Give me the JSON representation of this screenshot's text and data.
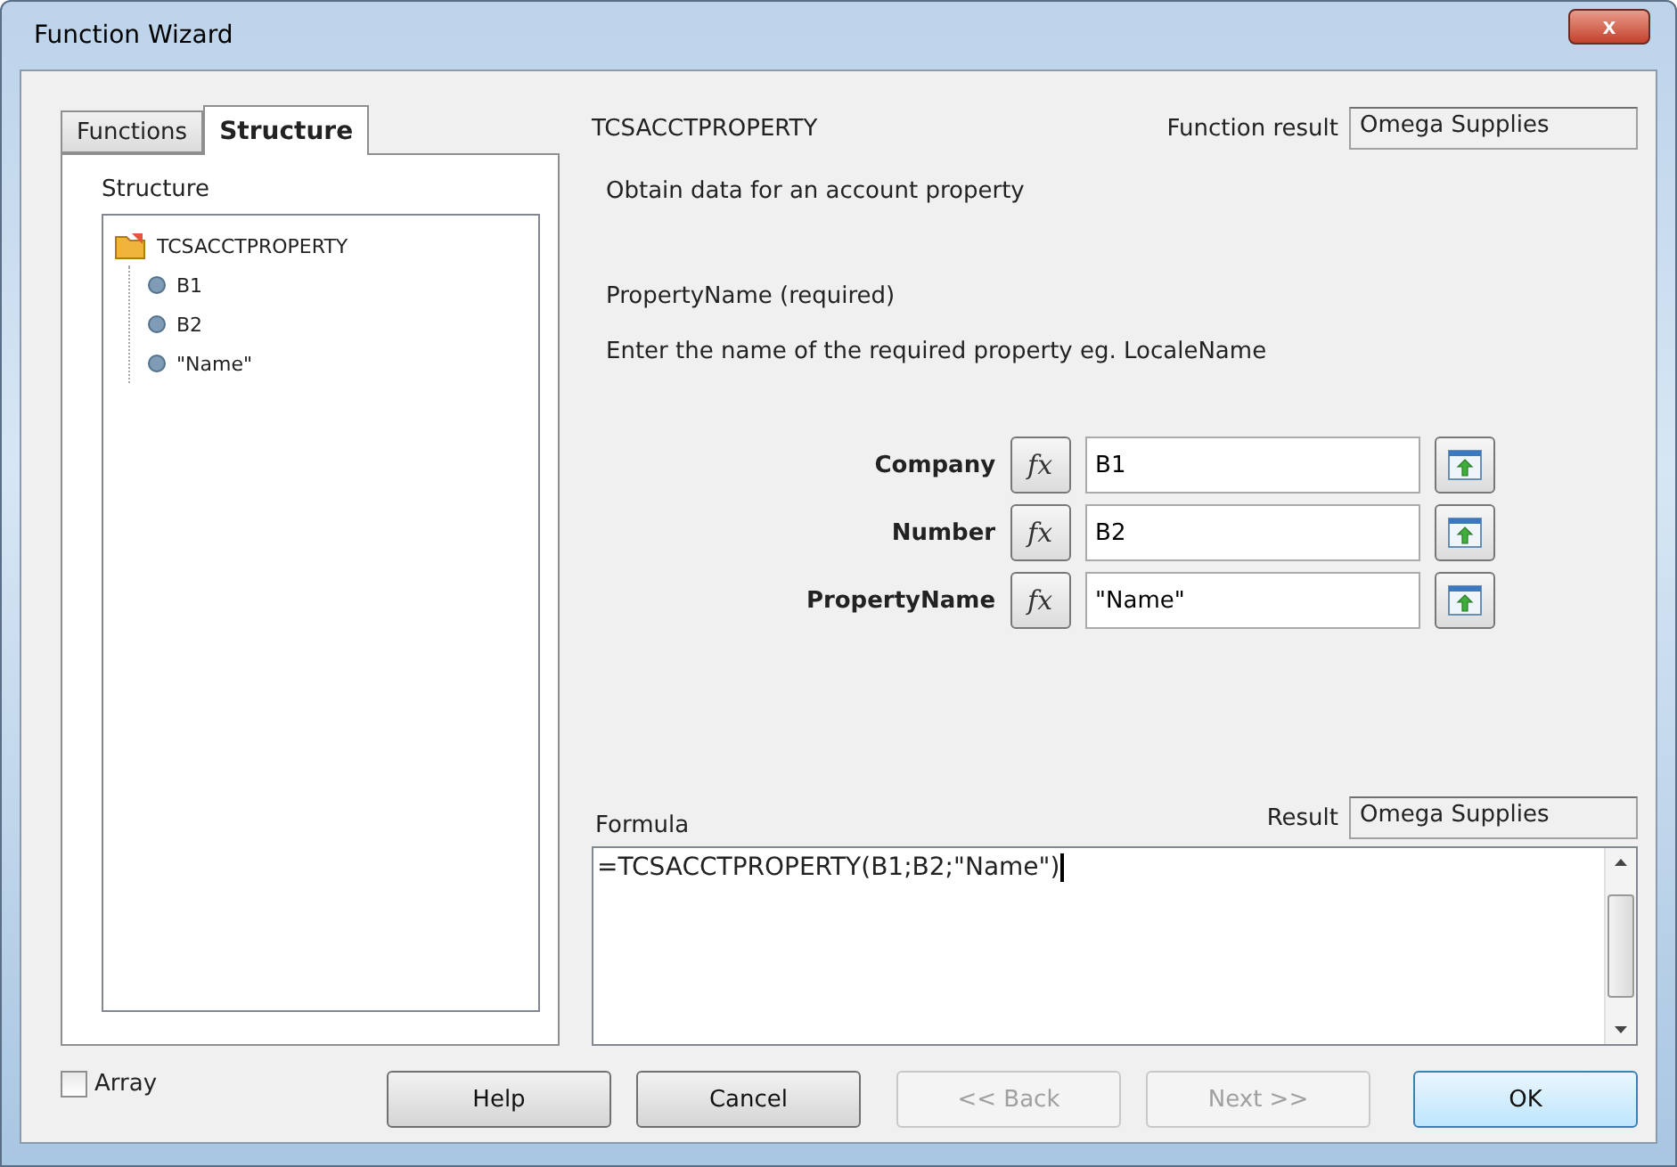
{
  "window": {
    "title": "Function Wizard",
    "close": "x"
  },
  "tabs": [
    {
      "label": "Functions",
      "selected": false
    },
    {
      "label": "Structure",
      "selected": true
    }
  ],
  "structure": {
    "label": "Structure",
    "tree": [
      {
        "kind": "function",
        "label": "TCSACCTPROPERTY",
        "children": [
          {
            "kind": "argument",
            "label": "B1"
          },
          {
            "kind": "argument",
            "label": "B2"
          },
          {
            "kind": "argument",
            "label": "\"Name\""
          }
        ]
      }
    ]
  },
  "function_name": "TCSACCTPROPERTY",
  "function_result": {
    "label": "Function result",
    "value": "Omega Supplies"
  },
  "description": "Obtain data for an account property",
  "argument_title": "PropertyName (required)",
  "argument_description": "Enter the name of the required property eg. LocaleName",
  "arguments": [
    {
      "label": "Company",
      "fx": "fx",
      "value": "B1"
    },
    {
      "label": "Number",
      "fx": "fx",
      "value": "B2"
    },
    {
      "label": "PropertyName",
      "fx": "fx",
      "value": "\"Name\""
    }
  ],
  "formula": {
    "label": "Formula",
    "value": "=TCSACCTPROPERTY(B1;B2;\"Name\")"
  },
  "result": {
    "label": "Result",
    "value": "Omega Supplies"
  },
  "array": {
    "label": "Array",
    "checked": false
  },
  "buttons": [
    {
      "label": "Help",
      "disabled": false,
      "default": false
    },
    {
      "label": "Cancel",
      "disabled": false,
      "default": false
    },
    {
      "label": "<< Back",
      "disabled": true,
      "default": false
    },
    {
      "label": "Next >>",
      "disabled": true,
      "default": false
    },
    {
      "label": "OK",
      "disabled": false,
      "default": true
    }
  ]
}
